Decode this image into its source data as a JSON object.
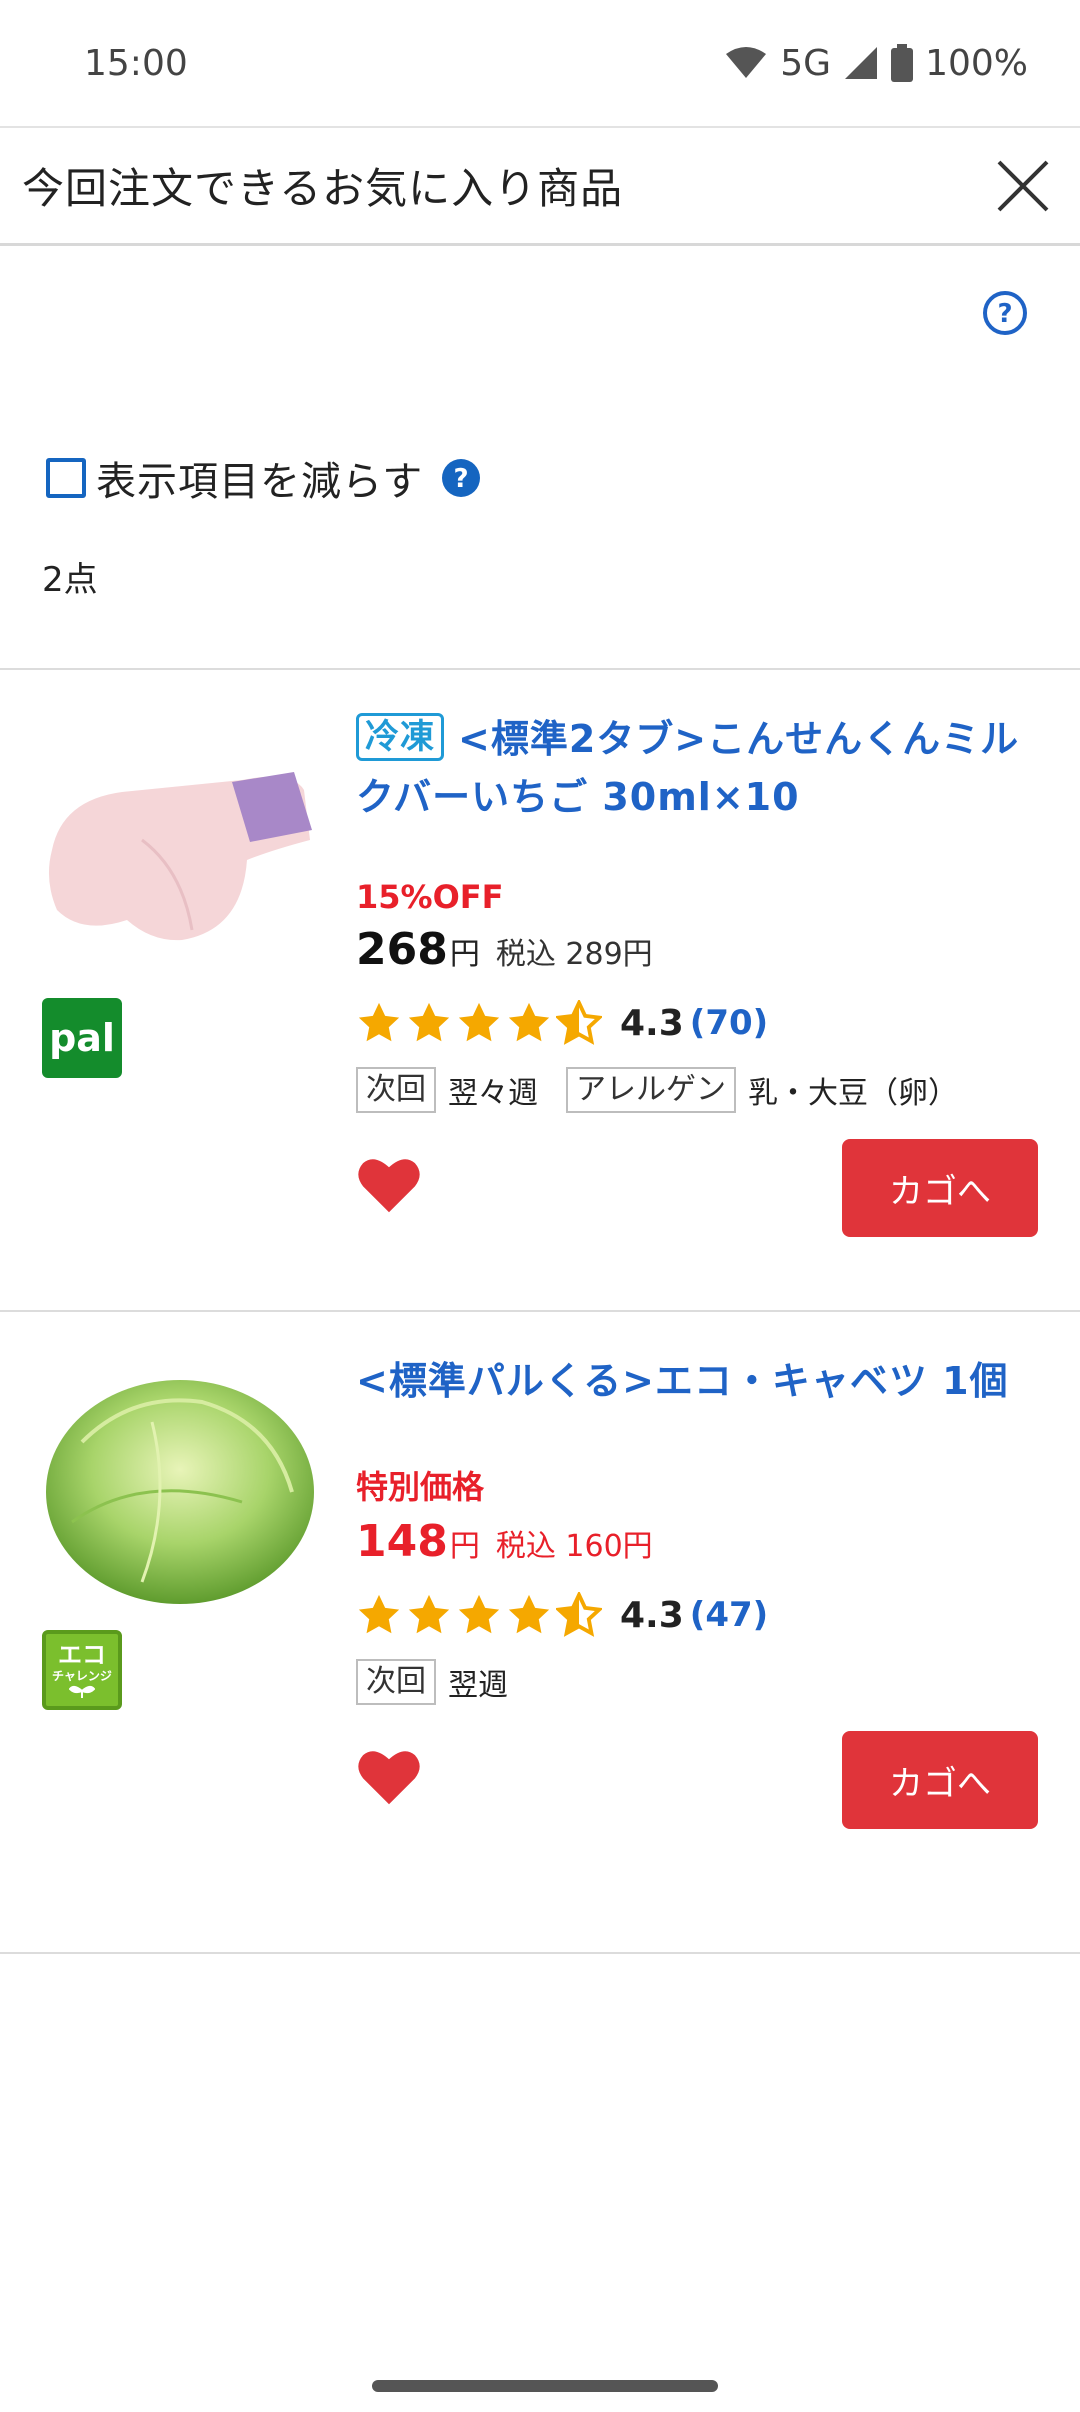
{
  "status": {
    "time": "15:00",
    "network": "5G",
    "battery": "100%"
  },
  "header": {
    "title": "今回注文できるお気に入り商品"
  },
  "filter": {
    "reduce_label": "表示項目を減らす",
    "count": "2点"
  },
  "products": [
    {
      "tag": "冷凍",
      "name": "<標準2タブ>こんせんくんミルクバーいちご 30ml×10",
      "promo": "15%OFF",
      "price": "268",
      "yen": "円",
      "tax_included": "税込 289円",
      "rating": "4.3",
      "reviews": "(70)",
      "next_label": "次回",
      "next_value": "翌々週",
      "allergen_label": "アレルゲン",
      "allergen_value": "乳・大豆（卵）",
      "brand_badge": "pal",
      "cart_label": "カゴへ"
    },
    {
      "name": "<標準パルくる>エコ・キャベツ 1個",
      "promo": "特別価格",
      "price": "148",
      "yen": "円",
      "tax_included": "税込 160円",
      "rating": "4.3",
      "reviews": "(47)",
      "next_label": "次回",
      "next_value": "翌週",
      "brand_badge_top": "エコ",
      "brand_badge_bottom": "チャレンジ",
      "cart_label": "カゴへ"
    }
  ],
  "colors": {
    "link": "#1f63c6",
    "promo": "#e8202a",
    "cart": "#e0343a",
    "star": "#f5a800"
  }
}
